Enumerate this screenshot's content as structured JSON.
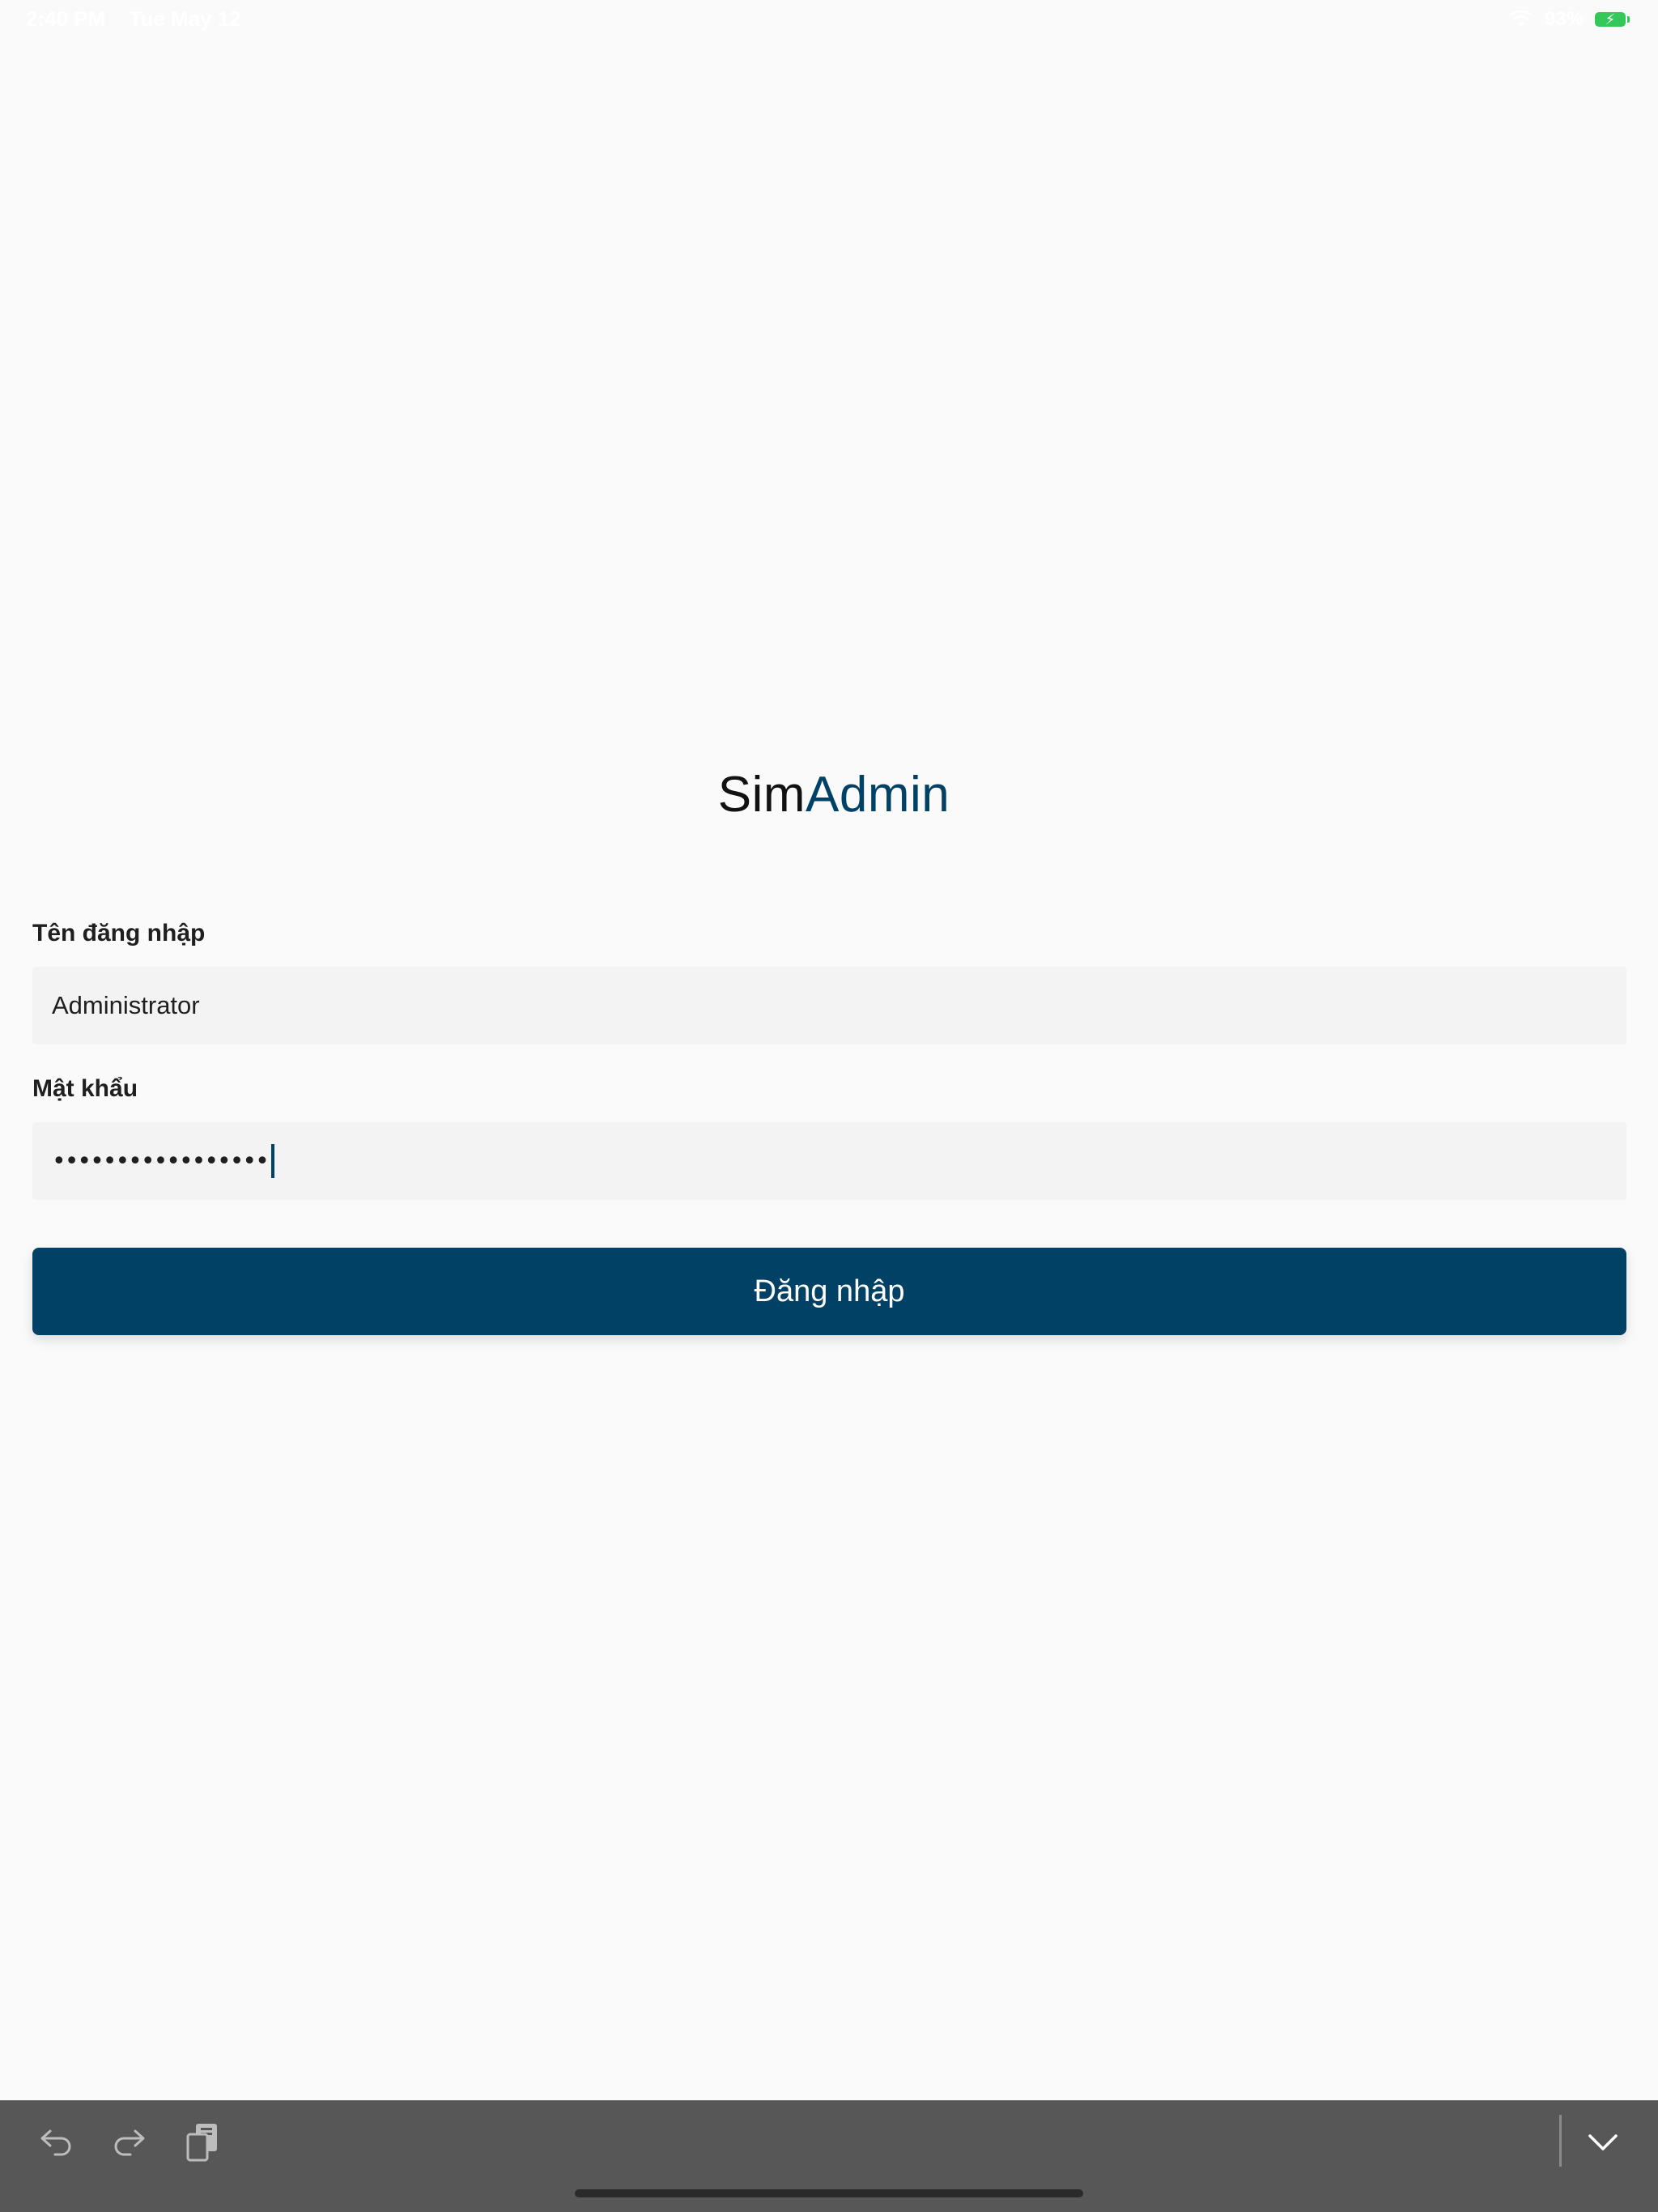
{
  "status_bar": {
    "time": "2:40 PM",
    "date": "Tue May 12",
    "battery_percent": "93%",
    "icons": [
      "wifi-icon",
      "battery-charging-icon"
    ]
  },
  "brand": {
    "part1": "Sim",
    "part2": "Admin",
    "accent_color": "#014165"
  },
  "form": {
    "username_label": "Tên đăng nhập",
    "username_value": "Administrator",
    "password_label": "Mật khẩu",
    "password_masked": "•••••••••••••••••",
    "submit_label": "Đăng nhập"
  },
  "keyboard_bar": {
    "icons": [
      "undo-icon",
      "redo-icon",
      "paste-icon",
      "keyboard-dismiss-icon"
    ]
  },
  "colors": {
    "background": "#fafafa",
    "primary": "#014165",
    "field_background": "#f3f3f3",
    "keyboard_bar": "#575757"
  }
}
